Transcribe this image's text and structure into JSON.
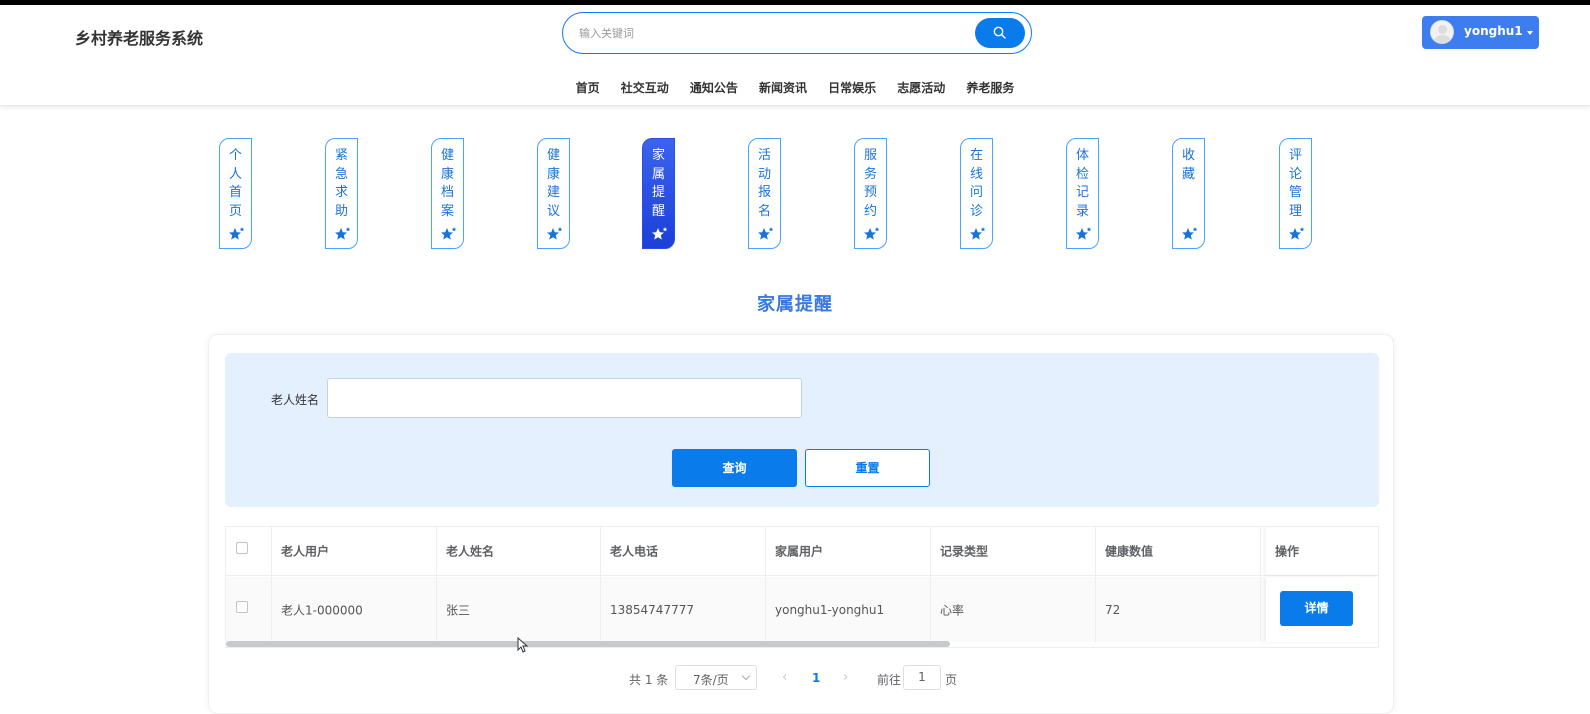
{
  "header": {
    "title": "乡村养老服务系统",
    "search_placeholder": "输入关键词",
    "user_name": "yonghu1",
    "nav": [
      "首页",
      "社交互动",
      "通知公告",
      "新闻资讯",
      "日常娱乐",
      "志愿活动",
      "养老服务"
    ]
  },
  "sidenav": {
    "items": [
      {
        "label": "个人首页",
        "active": false
      },
      {
        "label": "紧急求助",
        "active": false
      },
      {
        "label": "健康档案",
        "active": false
      },
      {
        "label": "健康建议",
        "active": false
      },
      {
        "label": "家属提醒",
        "active": true
      },
      {
        "label": "活动报名",
        "active": false
      },
      {
        "label": "服务预约",
        "active": false
      },
      {
        "label": "在线问诊",
        "active": false
      },
      {
        "label": "体检记录",
        "active": false
      },
      {
        "label": "收藏",
        "active": false
      },
      {
        "label": "评论管理",
        "active": false
      }
    ]
  },
  "page": {
    "title": "家属提醒"
  },
  "filter": {
    "label": "老人姓名",
    "value": "",
    "query_label": "查询",
    "reset_label": "重置"
  },
  "table": {
    "headers": [
      "老人用户",
      "老人姓名",
      "老人电话",
      "家属用户",
      "记录类型",
      "健康数值",
      "操作"
    ],
    "rows": [
      {
        "elder_user": "老人1-000000",
        "elder_name": "张三",
        "elder_phone": "13854747777",
        "family_user": "yonghu1-yonghu1",
        "record_type": "心率",
        "health_value": "72",
        "action_label": "详情"
      }
    ]
  },
  "pagination": {
    "total_text": "共 1 条",
    "page_size": "7条/页",
    "current_page": "1",
    "goto_label": "前往",
    "goto_value": "1",
    "page_suffix": "页"
  },
  "colors": {
    "primary": "#0a7bea",
    "active_tab": "#2a4ee0",
    "filter_bg": "#e5f0ff",
    "title": "#3a79e0"
  }
}
